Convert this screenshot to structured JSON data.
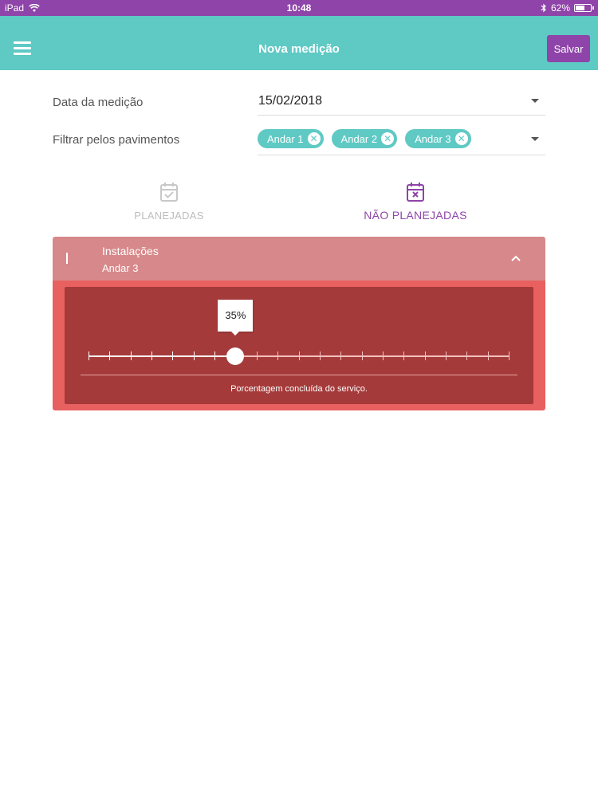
{
  "status_bar": {
    "carrier": "iPad",
    "time": "10:48",
    "battery_text": "62%",
    "battery_level": 0.62
  },
  "header": {
    "title": "Nova medição",
    "save_label": "Salvar",
    "accent_color": "#5fc9c4",
    "brand_color": "#8e44a8"
  },
  "form": {
    "date_label": "Data da medição",
    "date_value": "15/02/2018",
    "filter_label": "Filtrar pelos pavimentos",
    "chips": [
      {
        "label": "Andar 1"
      },
      {
        "label": "Andar 2"
      },
      {
        "label": "Andar 3"
      }
    ]
  },
  "tabs": [
    {
      "label": "PLANEJADAS",
      "icon": "calendar-check-icon",
      "active": false
    },
    {
      "label": "NÃO PLANEJADAS",
      "icon": "calendar-x-icon",
      "active": true
    }
  ],
  "panel": {
    "title": "Instalações",
    "subtitle": "Andar 3",
    "slider": {
      "value_label": "35%",
      "value_percent": 35,
      "tick_count": 21,
      "hint": "Porcentagem concluída do serviço."
    }
  }
}
